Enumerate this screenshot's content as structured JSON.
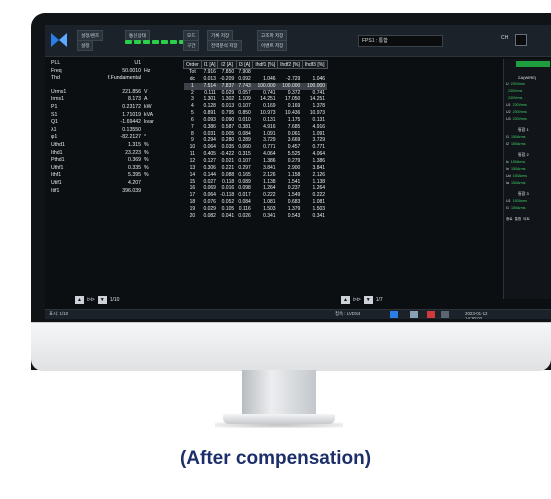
{
  "topbar": {
    "buttons": [
      "설정/렌즈",
      "설정",
      "통신상태",
      "이벤트"
    ],
    "labels": [
      "모드",
      "구간",
      "기록 저장",
      "전력분석 저장",
      "고조파 저장",
      "이벤트 저장"
    ],
    "fps_label": "FPS1 : 통합",
    "ch_label": "CH"
  },
  "left": {
    "header": [
      {
        "k": "PLL",
        "v": "U1",
        "u": ""
      },
      {
        "k": "Freq",
        "v": "50.0010",
        "u": "Hz"
      },
      {
        "k": "Thd",
        "v": "f.Fundamental",
        "u": ""
      }
    ],
    "values": [
      {
        "k": "Urms1",
        "v": "221.856",
        "u": "V"
      },
      {
        "k": "Irms1",
        "v": "8.173",
        "u": "A"
      },
      {
        "k": "P1",
        "v": "0.23172",
        "u": "kW"
      },
      {
        "k": "S1",
        "v": "1.71019",
        "u": "kVA"
      },
      {
        "k": "Q1",
        "v": "-1.69442",
        "u": "kvar"
      },
      {
        "k": "λ1",
        "v": "0.13550",
        "u": ""
      },
      {
        "k": "φ1",
        "v": "-82.2127",
        "u": "°"
      },
      {
        "k": "Uthd1",
        "v": "1.315",
        "u": "%"
      },
      {
        "k": "Ithd1",
        "v": "23.223",
        "u": "%"
      },
      {
        "k": "Pthd1",
        "v": "0.369",
        "u": "%"
      },
      {
        "k": "Uthf1",
        "v": "0.335",
        "u": "%"
      },
      {
        "k": "Ithf1",
        "v": "5.395",
        "u": "%"
      },
      {
        "k": "Utif1",
        "v": "4.207",
        "u": ""
      },
      {
        "k": "Itif1",
        "v": "396.039",
        "u": ""
      }
    ],
    "pager": {
      "btn": "◀  ▶",
      "page": "1/10"
    }
  },
  "table": {
    "headers": [
      "Order",
      "I1 [A]",
      "I2 [A]",
      "I3 [A]",
      "Ihdf1 [%]",
      "Ihdf2 [%]",
      "Ihdf3 [%]"
    ],
    "rows": [
      [
        "Tot",
        "7.916",
        "7.850",
        "7.908",
        "",
        "",
        ""
      ],
      [
        "dc",
        "0.013",
        "-0.209",
        "0.092",
        "1.046",
        "-2.729",
        "1.046"
      ],
      [
        "1",
        "7.514",
        "7.837",
        "7.743",
        "100.000",
        "100.000",
        "100.000"
      ],
      [
        "2",
        "0.111",
        "0.029",
        "0.057",
        "0.741",
        "0.372",
        "0.741"
      ],
      [
        "3",
        "1.301",
        "1.302",
        "1.109",
        "14.251",
        "17.050",
        "14.251"
      ],
      [
        "4",
        "0.128",
        "0.013",
        "0.107",
        "0.169",
        "0.169",
        "1.378"
      ],
      [
        "5",
        "0.891",
        "0.795",
        "0.850",
        "10.973",
        "10.436",
        "10.973"
      ],
      [
        "6",
        "0.093",
        "0.090",
        "0.010",
        "0.131",
        "1.175",
        "0.131"
      ],
      [
        "7",
        "0.386",
        "0.587",
        "0.381",
        "4.916",
        "7.685",
        "4.916"
      ],
      [
        "8",
        "0.031",
        "0.005",
        "0.084",
        "1.091",
        "0.061",
        "1.091"
      ],
      [
        "9",
        "0.294",
        "0.280",
        "0.289",
        "3.729",
        "3.669",
        "3.729"
      ],
      [
        "10",
        "0.064",
        "0.035",
        "0.060",
        "0.771",
        "0.457",
        "0.771"
      ],
      [
        "11",
        "0.405",
        "-0.422",
        "0.315",
        "4.064",
        "5.525",
        "4.064"
      ],
      [
        "12",
        "0.127",
        "0.021",
        "0.107",
        "1.386",
        "0.279",
        "1.386"
      ],
      [
        "13",
        "0.306",
        "0.221",
        "0.297",
        "3.841",
        "2.900",
        "3.841"
      ],
      [
        "14",
        "0.144",
        "0.088",
        "0.165",
        "2.126",
        "1.158",
        "2.126"
      ],
      [
        "15",
        "0.027",
        "0.118",
        "0.089",
        "1.138",
        "1.541",
        "1.138"
      ],
      [
        "16",
        "0.069",
        "0.016",
        "0.098",
        "1.264",
        "0.237",
        "1.264"
      ],
      [
        "17",
        "0.064",
        "-0.118",
        "0.017",
        "0.222",
        "1.549",
        "0.222"
      ],
      [
        "18",
        "0.076",
        "0.052",
        "0.084",
        "1.081",
        "0.683",
        "1.081"
      ],
      [
        "19",
        "0.029",
        "0.105",
        "0.116",
        "1.503",
        "1.379",
        "1.503"
      ],
      [
        "20",
        "0.082",
        "0.041",
        "0.026",
        "0.341",
        "0.543",
        "0.341"
      ]
    ],
    "pager": {
      "page": "1/7"
    }
  },
  "right": {
    "title": "ΣA(WIRE)",
    "rows": [
      {
        "k": "U",
        "g": "230Vrms"
      },
      {
        "k": "",
        "g": "230Vrms"
      },
      {
        "k": "",
        "g": "230Vrms"
      },
      {
        "k": "U1",
        "g": "230Vrms"
      },
      {
        "k": "U2",
        "g": "230Vrms"
      },
      {
        "k": "U3",
        "g": "230Vrms"
      }
    ],
    "sec1": "통합 1",
    "rows2": [
      {
        "k": "I1",
        "g": "150Arms"
      },
      {
        "k": "I2",
        "g": "150Arms"
      }
    ],
    "sec2": "통합 2",
    "rows3": [
      {
        "k": "Ic",
        "g": "150Arms"
      },
      {
        "k": "In",
        "g": "150Arms"
      },
      {
        "k": "Ud",
        "g": "150Arms"
      },
      {
        "k": "Ia",
        "g": "150Arms"
      }
    ],
    "sec3": "통합 3",
    "rows4": [
      {
        "k": "U1",
        "g": "150Arms"
      },
      {
        "k": "I1",
        "g": "150Arms"
      }
    ],
    "bottom": [
      "종료",
      "통합",
      "비트"
    ]
  },
  "status": {
    "left": "표시: 1/10",
    "mid": "접속 : LVDS4",
    "time": "2023-01-12 14:30:02"
  },
  "caption": "(After compensation)",
  "colors": {
    "led": "#2bd04a",
    "caption": "#1d2f6b",
    "accent_green": "#1f9e3d"
  }
}
